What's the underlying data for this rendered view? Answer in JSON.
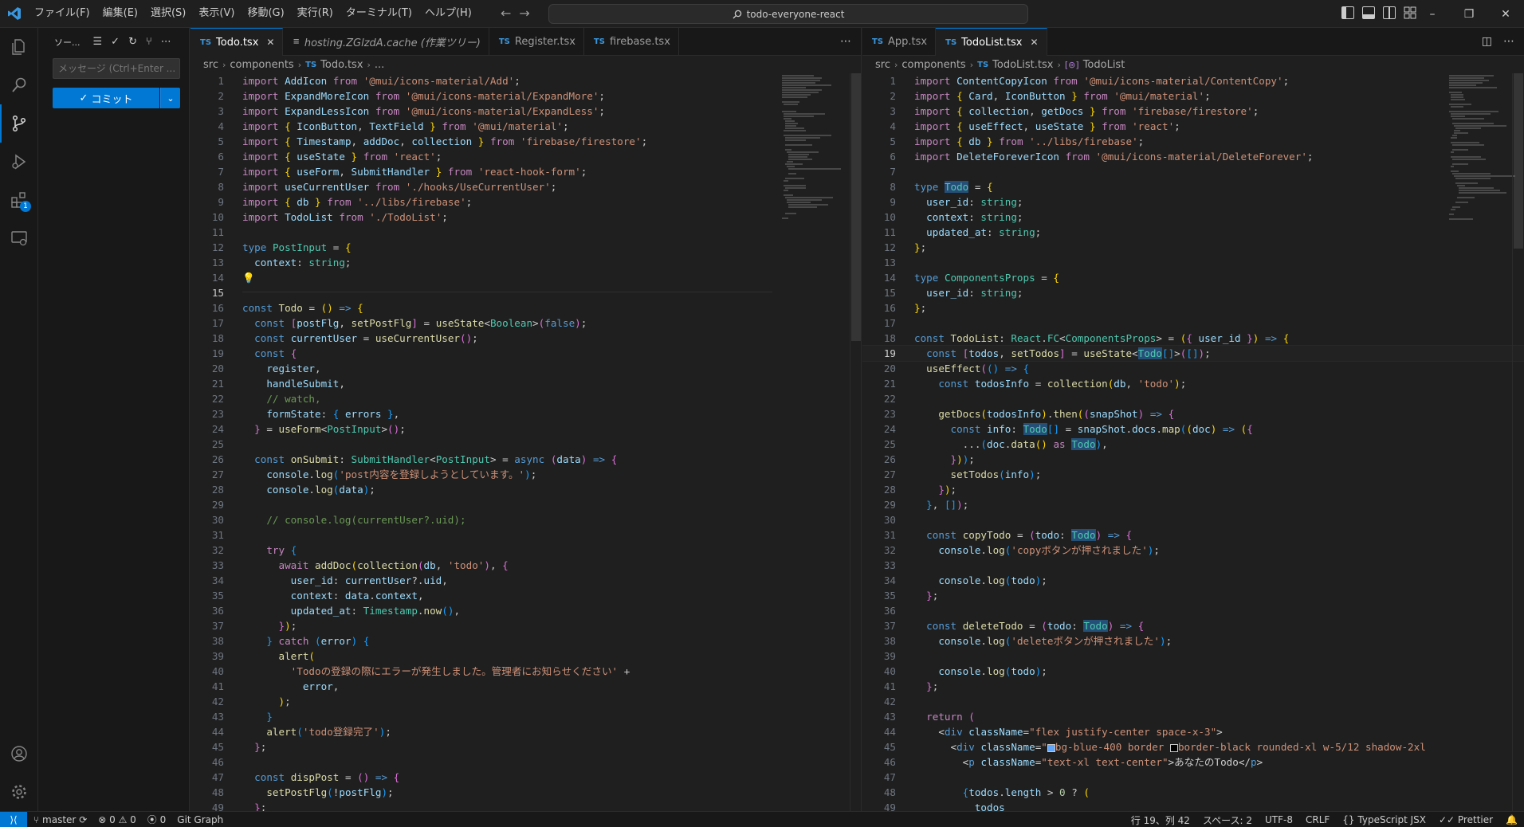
{
  "title_bar": {
    "menus": [
      "ファイル(F)",
      "編集(E)",
      "選択(S)",
      "表示(V)",
      "移動(G)",
      "実行(R)",
      "ターミナル(T)",
      "ヘルプ(H)"
    ],
    "search_text": "todo-everyone-react"
  },
  "sidebar": {
    "title": "ソー...",
    "message_placeholder": "メッセージ (Ctrl+Enter ...",
    "commit_label": "コミット",
    "extensions_badge": "1"
  },
  "editor_left": {
    "tabs": [
      {
        "label": "Todo.tsx",
        "active": true,
        "ftype": "TS"
      },
      {
        "label": "hosting.ZGlzdA.cache (作業ツリー)",
        "active": false,
        "ftype": "≡"
      },
      {
        "label": "Register.tsx",
        "active": false,
        "ftype": "TS"
      },
      {
        "label": "firebase.tsx",
        "active": false,
        "ftype": "TS"
      }
    ],
    "breadcrumb": [
      "src",
      "components",
      "Todo.tsx",
      "..."
    ]
  },
  "editor_right": {
    "tabs": [
      {
        "label": "App.tsx",
        "active": false,
        "ftype": "TS"
      },
      {
        "label": "TodoList.tsx",
        "active": true,
        "ftype": "TS"
      }
    ],
    "breadcrumb": [
      "src",
      "components",
      "TodoList.tsx",
      "TodoList"
    ]
  },
  "status_bar": {
    "branch": "master",
    "problems": "⊗ 0 ⚠ 0",
    "ports": "0",
    "git_graph": "Git Graph",
    "position": "行 19、列 42",
    "spaces": "スペース: 2",
    "encoding": "UTF-8",
    "eol": "CRLF",
    "language": "TypeScript JSX",
    "formatter": "Prettier"
  },
  "colors": {
    "accent": "#0078d4",
    "editor_bg": "#1f1f1f",
    "sidebar_bg": "#181818"
  }
}
